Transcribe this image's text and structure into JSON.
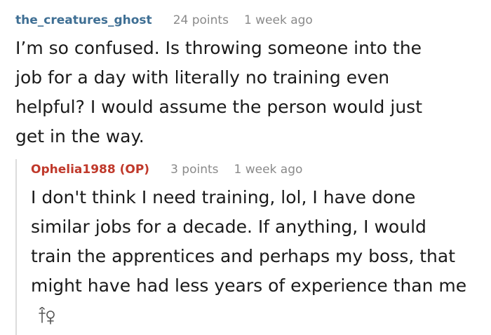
{
  "comment": {
    "username": "the_creatures_ghost",
    "points": "24 points",
    "time": "1 week ago",
    "body": "I’m so confused. Is throwing someone into the\njob for a day with literally no training even\nhelpful? I would assume the person would just\nget in the way."
  },
  "reply": {
    "username": "Ophelia1988 (OP)",
    "points": "3 points",
    "time": "1 week ago",
    "body": "I don't think I need training, lol, I have done\nsimilar jobs for a decade. If anything, I would\ntrain the apprentices and perhaps my boss, that\nmight have had less years of experience than me",
    "author_badge_icon": "gender-badge-icon"
  },
  "colors": {
    "username_default": "#3f6f94",
    "username_op": "#c0392b",
    "meta_gray": "#8a8a8a",
    "thread_line": "#dcdcdc"
  }
}
